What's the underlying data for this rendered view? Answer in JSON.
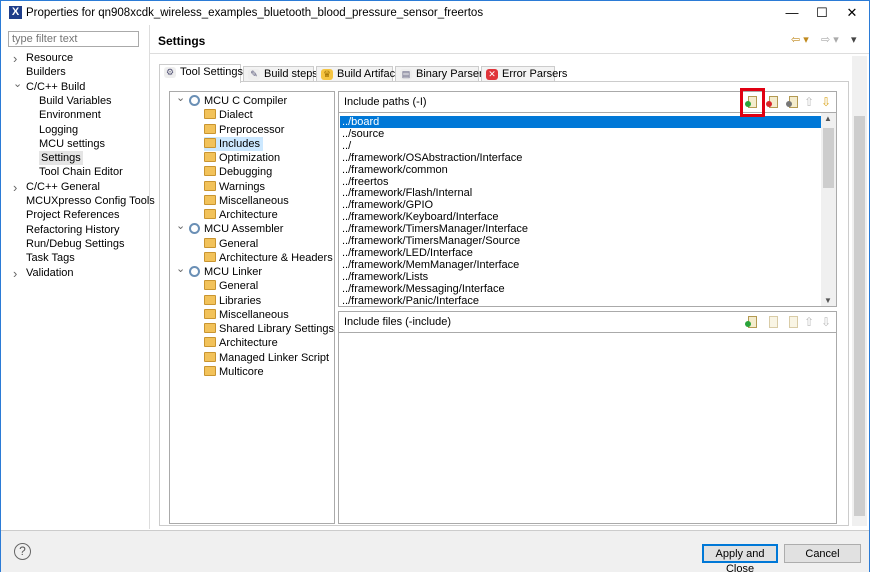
{
  "window": {
    "title": "Properties for qn908xcdk_wireless_examples_bluetooth_blood_pressure_sensor_freertos",
    "controls": [
      "—",
      "☐",
      "✕"
    ]
  },
  "filter": {
    "placeholder": "type filter text"
  },
  "left_tree": [
    {
      "label": "Resource",
      "level": 0,
      "chevron": "›"
    },
    {
      "label": "Builders",
      "level": 0
    },
    {
      "label": "C/C++ Build",
      "level": 0,
      "chevron": "⌄"
    },
    {
      "label": "Build Variables",
      "level": 1
    },
    {
      "label": "Environment",
      "level": 1
    },
    {
      "label": "Logging",
      "level": 1
    },
    {
      "label": "MCU settings",
      "level": 1
    },
    {
      "label": "Settings",
      "level": 1,
      "selected": true
    },
    {
      "label": "Tool Chain Editor",
      "level": 1
    },
    {
      "label": "C/C++ General",
      "level": 0,
      "chevron": "›"
    },
    {
      "label": "MCUXpresso Config Tools",
      "level": 0
    },
    {
      "label": "Project References",
      "level": 0
    },
    {
      "label": "Refactoring History",
      "level": 0
    },
    {
      "label": "Run/Debug Settings",
      "level": 0
    },
    {
      "label": "Task Tags",
      "level": 0
    },
    {
      "label": "Validation",
      "level": 0,
      "chevron": "›"
    }
  ],
  "header": {
    "title": "Settings"
  },
  "tabs": [
    {
      "label": "Tool Settings",
      "active": true,
      "icon": "gear-icon"
    },
    {
      "label": "Build steps",
      "icon": "hammer-icon"
    },
    {
      "label": "Build Artifact",
      "icon": "trophy-icon"
    },
    {
      "label": "Binary Parsers",
      "icon": "binary-icon"
    },
    {
      "label": "Error Parsers",
      "icon": "error-icon"
    }
  ],
  "tool_tree": [
    {
      "label": "MCU C Compiler",
      "group": true
    },
    {
      "label": "Dialect"
    },
    {
      "label": "Preprocessor"
    },
    {
      "label": "Includes",
      "selected": true
    },
    {
      "label": "Optimization"
    },
    {
      "label": "Debugging"
    },
    {
      "label": "Warnings"
    },
    {
      "label": "Miscellaneous"
    },
    {
      "label": "Architecture"
    },
    {
      "label": "MCU Assembler",
      "group": true
    },
    {
      "label": "General"
    },
    {
      "label": "Architecture & Headers"
    },
    {
      "label": "MCU Linker",
      "group": true
    },
    {
      "label": "General"
    },
    {
      "label": "Libraries"
    },
    {
      "label": "Miscellaneous"
    },
    {
      "label": "Shared Library Settings"
    },
    {
      "label": "Architecture"
    },
    {
      "label": "Managed Linker Script"
    },
    {
      "label": "Multicore"
    }
  ],
  "include_paths": {
    "title": "Include paths (-I)",
    "items": [
      "../board",
      "../source",
      "../",
      "../framework/OSAbstraction/Interface",
      "../framework/common",
      "../freertos",
      "../framework/Flash/Internal",
      "../framework/GPIO",
      "../framework/Keyboard/Interface",
      "../framework/TimersManager/Interface",
      "../framework/TimersManager/Source",
      "../framework/LED/Interface",
      "../framework/MemManager/Interface",
      "../framework/Lists",
      "../framework/Messaging/Interface",
      "../framework/Panic/Interface"
    ],
    "selected": 0
  },
  "include_files": {
    "title": "Include files (-include)",
    "items": []
  },
  "buttons": {
    "apply_close": "Apply and Close",
    "cancel": "Cancel",
    "help": "?"
  },
  "colors": {
    "selection": "#0078d7",
    "highlight_box": "#e00012",
    "accent_border": "#2b7bd6"
  }
}
